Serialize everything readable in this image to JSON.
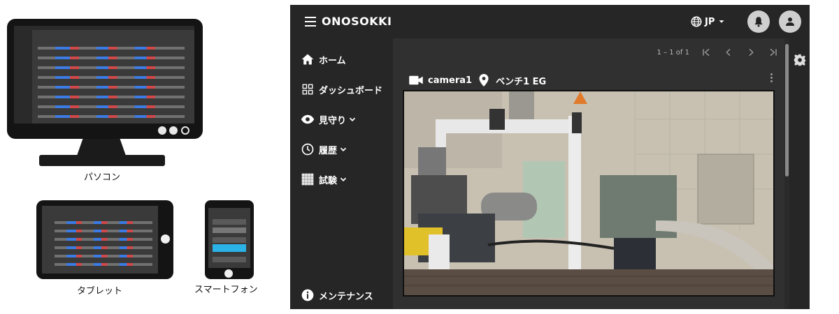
{
  "devices": {
    "pc_label": "パソコン",
    "tablet_label": "タブレット",
    "phone_label": "スマートフォン"
  },
  "app": {
    "brand": "ONOSOKKI",
    "language": "JP",
    "icons": {
      "menu": "hamburger-icon",
      "language": "globe-icon",
      "notifications": "bell-icon",
      "account": "account-icon",
      "settings": "gear-icon"
    },
    "sidebar": {
      "items": [
        {
          "label": "ホーム",
          "icon": "home-icon"
        },
        {
          "label": "ダッシュボード",
          "icon": "dashboard-grid-icon"
        },
        {
          "label": "見守り",
          "icon": "eye-icon",
          "expandable": true
        },
        {
          "label": "履歴",
          "icon": "clock-icon",
          "expandable": true
        },
        {
          "label": "試験",
          "icon": "test-grid-icon",
          "expandable": true
        }
      ],
      "footer": {
        "label": "メンテナンス",
        "icon": "info-icon"
      }
    },
    "pager": {
      "range": "1 – 1 of 1"
    },
    "camera": {
      "name": "camera1",
      "location": "ベンチ1 EG"
    }
  }
}
